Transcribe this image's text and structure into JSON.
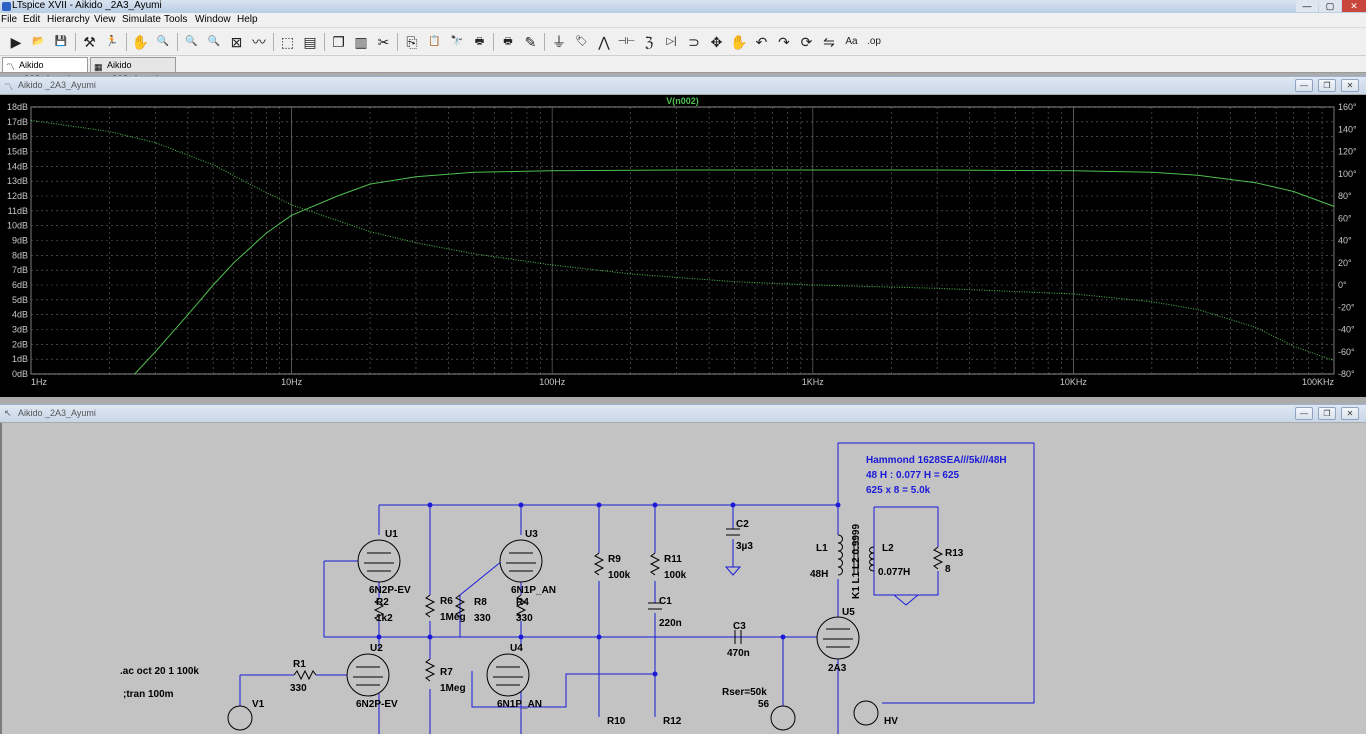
{
  "window": {
    "title": "LTspice XVII - Aikido _2A3_Ayumi",
    "min": "—",
    "max": "▢",
    "close": "✕"
  },
  "menu": [
    "File",
    "Edit",
    "Hierarchy",
    "View",
    "Simulate",
    "Tools",
    "Window",
    "Help"
  ],
  "toolbar_icons": [
    "open-icon",
    "folder-icon",
    "save-icon",
    "hammer-icon",
    "run-icon",
    "hand-icon",
    "zoom-in-icon",
    "zoom-out-icon",
    "zoom-fit-icon",
    "zoom-cancel-icon",
    "waveform-icon",
    "autorange-icon",
    "tile-horizontal-icon",
    "cascade-icon",
    "tile-vertical-icon",
    "cut-icon",
    "copy-icon",
    "paste-icon",
    "find-icon",
    "print-icon",
    "print-setup-icon",
    "pencil-icon",
    "ground-icon",
    "label-icon",
    "resistor-icon",
    "capacitor-icon",
    "inductor-icon",
    "diode-icon",
    "component-icon",
    "move-icon",
    "drag-icon",
    "undo-icon",
    "redo-icon",
    "rotate-icon",
    "mirror-icon",
    "text-icon",
    "spice-directive-icon"
  ],
  "toolbar_glyphs": [
    "▶",
    "📂",
    "💾",
    "⚒",
    "🏃",
    "✋",
    "🔍",
    "🔍",
    "🔍",
    "⊠",
    "〰",
    "⬚",
    "▤",
    "❐",
    "▥",
    "✂",
    "⎘",
    "📋",
    "🔭",
    "🖶",
    "🖶",
    "✎",
    "⏚",
    "🏷",
    "⋀",
    "⊣⊢",
    "ℨ",
    "▷|",
    "⊃",
    "✥",
    "✋",
    "↶",
    "↷",
    "⟳",
    "⇋",
    "Aa",
    ".op"
  ],
  "tabs": [
    {
      "label": "Aikido _2A3_Ayumi",
      "icon": "waveform-tab-icon",
      "glyph": "〽"
    },
    {
      "label": "Aikido _2A3_Ayumi",
      "icon": "schematic-tab-icon",
      "glyph": "▦"
    }
  ],
  "plot_window": {
    "title": "Aikido _2A3_Ayumi",
    "icon_glyph": "〽"
  },
  "schematic_window": {
    "title": "Aikido _2A3_Ayumi",
    "icon_glyph": "↖"
  },
  "chart_data": {
    "type": "line",
    "title": "V(n002)",
    "x_scale": "log",
    "x_range": [
      1,
      100000
    ],
    "x_tick_labels": [
      "1Hz",
      "10Hz",
      "100Hz",
      "1KHz",
      "10KHz",
      "100KHz"
    ],
    "y_left_range": [
      0,
      18
    ],
    "y_left_ticks": [
      "0dB",
      "1dB",
      "2dB",
      "3dB",
      "4dB",
      "5dB",
      "6dB",
      "7dB",
      "8dB",
      "9dB",
      "10dB",
      "11dB",
      "12dB",
      "13dB",
      "14dB",
      "15dB",
      "16dB",
      "17dB",
      "18dB"
    ],
    "y_right_range": [
      -80,
      160
    ],
    "y_right_ticks": [
      "-80°",
      "-60°",
      "-40°",
      "-20°",
      "0°",
      "20°",
      "40°",
      "60°",
      "80°",
      "100°",
      "120°",
      "140°",
      "160°"
    ],
    "grid": true,
    "color": "#4fc04f",
    "series": [
      {
        "axis": "left",
        "x": [
          2.5,
          3,
          4,
          5,
          6,
          8,
          10,
          15,
          20,
          30,
          50,
          100,
          300,
          1000,
          3000,
          10000,
          20000,
          30000,
          50000,
          70000,
          100000
        ],
        "values": [
          0,
          1.5,
          4,
          6,
          7.5,
          9.5,
          10.7,
          12,
          12.8,
          13.3,
          13.6,
          13.7,
          13.75,
          13.75,
          13.75,
          13.7,
          13.6,
          13.4,
          12.9,
          12.3,
          11.3
        ]
      },
      {
        "axis": "right",
        "x": [
          1,
          2,
          3,
          5,
          7,
          10,
          20,
          30,
          50,
          100,
          200,
          500,
          1000,
          3000,
          10000,
          20000,
          30000,
          50000,
          70000,
          100000
        ],
        "values": [
          148,
          138,
          128,
          108,
          90,
          72,
          48,
          38,
          28,
          18,
          10,
          3,
          0,
          -3,
          -8,
          -15,
          -22,
          -38,
          -55,
          -68
        ]
      }
    ]
  },
  "schematic": {
    "wire_color": "#1a1ad8",
    "labels": {
      "u1": "U1",
      "u1_model": "6N2P-EV",
      "u2": "U2",
      "u2_model": "6N2P-EV",
      "u3": "U3",
      "u3_model": "6N1P_AN",
      "u4": "U4",
      "u4_model": "6N1P_AN",
      "u5": "U5",
      "u5_model": "2A3",
      "r1": "R1",
      "r1_val": "330",
      "r2": "R2",
      "r2_val": "1k2",
      "r4": "R4",
      "r4_val": "330",
      "r6": "R6",
      "r6_val": "1Meg",
      "r7": "R7",
      "r7_val": "1Meg",
      "r8": "R8",
      "r8_val": "330",
      "r9": "R9",
      "r9_val": "100k",
      "r10": "R10",
      "r11": "R11",
      "r11_val": "100k",
      "r12": "R12",
      "r13": "R13",
      "r13_val": "8",
      "c1": "C1",
      "c1_val": "220n",
      "c2": "C2",
      "c2_val": "3µ3",
      "c3": "C3",
      "c3_val": "470n",
      "l1": "L1",
      "l1_val": "48H",
      "l2": "L2",
      "l2_val": "0.077H",
      "k1": "K1 L1 L2 0.9999",
      "v1": "V1",
      "rser": "Rser=50k",
      "rser_val": "56",
      "hv": "HV",
      "ac_directive": ".ac oct 20 1 100k",
      "tran_directive": ";tran 100m",
      "note1": "Hammond 1628SEA///5k///48H",
      "note2": "48 H : 0.077 H = 625",
      "note3": "625 x 8 = 5.0k"
    }
  }
}
